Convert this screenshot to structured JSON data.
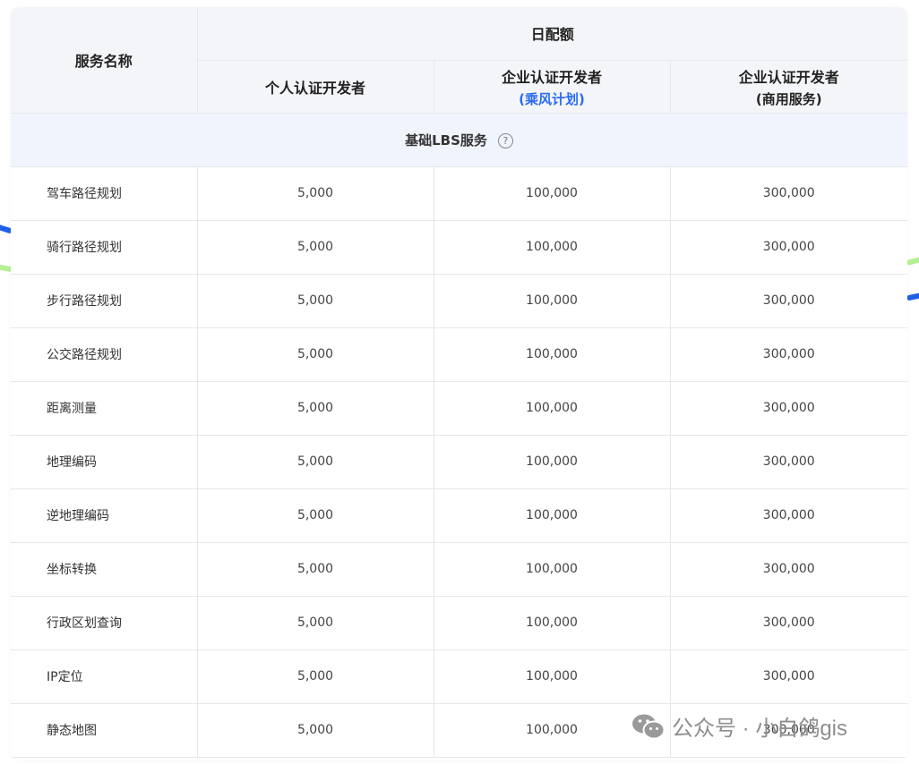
{
  "header": {
    "service_name": "服务名称",
    "daily_quota": "日配额",
    "col_personal": "个人认证开发者",
    "col_enterprise": "企业认证开发者",
    "col_enterprise_sub": "(乘风计划)",
    "col_commercial": "企业认证开发者",
    "col_commercial_sub": "(商用服务)"
  },
  "section": {
    "title": "基础LBS服务",
    "help_icon": "question-circle-icon",
    "help_glyph": "?"
  },
  "rows": [
    {
      "name": "驾车路径规划",
      "personal": "5,000",
      "enterprise": "100,000",
      "commercial": "300,000"
    },
    {
      "name": "骑行路径规划",
      "personal": "5,000",
      "enterprise": "100,000",
      "commercial": "300,000"
    },
    {
      "name": "步行路径规划",
      "personal": "5,000",
      "enterprise": "100,000",
      "commercial": "300,000"
    },
    {
      "name": "公交路径规划",
      "personal": "5,000",
      "enterprise": "100,000",
      "commercial": "300,000"
    },
    {
      "name": "距离测量",
      "personal": "5,000",
      "enterprise": "100,000",
      "commercial": "300,000"
    },
    {
      "name": "地理编码",
      "personal": "5,000",
      "enterprise": "100,000",
      "commercial": "300,000"
    },
    {
      "name": "逆地理编码",
      "personal": "5,000",
      "enterprise": "100,000",
      "commercial": "300,000"
    },
    {
      "name": "坐标转换",
      "personal": "5,000",
      "enterprise": "100,000",
      "commercial": "300,000"
    },
    {
      "name": "行政区划查询",
      "personal": "5,000",
      "enterprise": "100,000",
      "commercial": "300,000"
    },
    {
      "name": "IP定位",
      "personal": "5,000",
      "enterprise": "100,000",
      "commercial": "300,000"
    },
    {
      "name": "静态地图",
      "personal": "5,000",
      "enterprise": "100,000",
      "commercial": "300,000"
    }
  ],
  "watermark": {
    "text": "公众号 · 小白鸽gis",
    "icon": "wechat-icon"
  },
  "colors": {
    "accent_blue": "#2a6cf2",
    "header_bg": "#f4f5f8",
    "section_bg": "#f0f4fd",
    "border": "#e4e7ec"
  }
}
